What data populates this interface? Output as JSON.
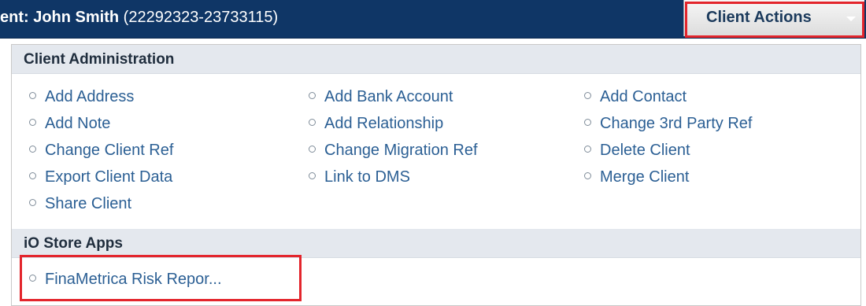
{
  "header": {
    "client_prefix": "ent: ",
    "client_name": "John Smith",
    "client_ref": " (22292323-23733115)",
    "actions_label": "Client Actions"
  },
  "sections": {
    "admin": {
      "title": "Client Administration",
      "items": [
        "Add Address",
        "Add Bank Account",
        "Add Contact",
        "Add Note",
        "Add Relationship",
        "Change 3rd Party Ref",
        "Change Client Ref",
        "Change Migration Ref",
        "Delete Client",
        "Export Client Data",
        "Link to DMS",
        "Merge Client",
        "Share Client"
      ]
    },
    "store": {
      "title": "iO Store Apps",
      "items": [
        "FinaMetrica Risk Repor..."
      ]
    }
  },
  "colors": {
    "header_bg": "#0f3666",
    "link": "#2b5f94",
    "highlight": "#e3252c",
    "section_bg": "#e4e8ee"
  },
  "icons": {
    "bullet": "circle-bullet-icon",
    "dropdown": "caret-down-icon"
  }
}
